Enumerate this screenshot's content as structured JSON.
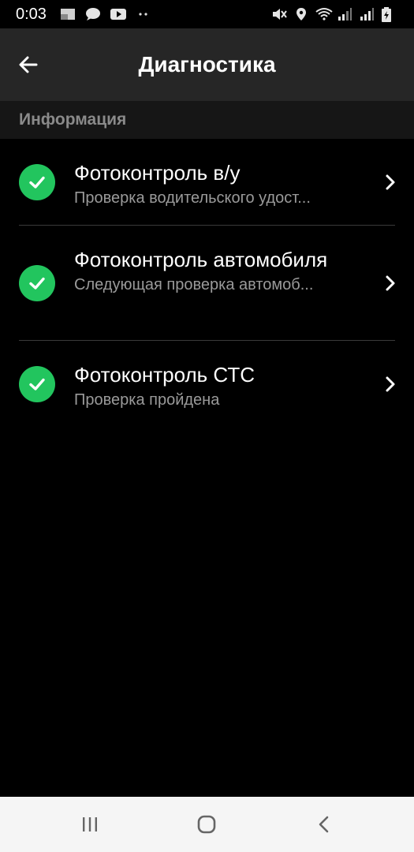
{
  "status_bar": {
    "time": "0:03",
    "icons_left": [
      "gallery-icon",
      "message-bubble-icon",
      "youtube-icon",
      "more-dots-icon"
    ],
    "icons_right": [
      "mute-icon",
      "location-icon",
      "wifi-icon",
      "signal-icon",
      "signal-icon-2",
      "battery-icon"
    ]
  },
  "app_bar": {
    "title": "Диагностика"
  },
  "section": {
    "title": "Информация"
  },
  "items": [
    {
      "title": "Фотоконтроль в/у",
      "subtitle": "Проверка водительского удост...",
      "status": "passed"
    },
    {
      "title": "Фотоконтроль автомобиля",
      "subtitle": "Следующая проверка автомоб...",
      "status": "passed"
    },
    {
      "title": "Фотоконтроль СТС",
      "subtitle": "Проверка пройдена",
      "status": "passed"
    }
  ],
  "colors": {
    "success": "#22c55e",
    "app_bar_bg": "#262626",
    "section_bg": "#161616",
    "background": "#000000"
  }
}
